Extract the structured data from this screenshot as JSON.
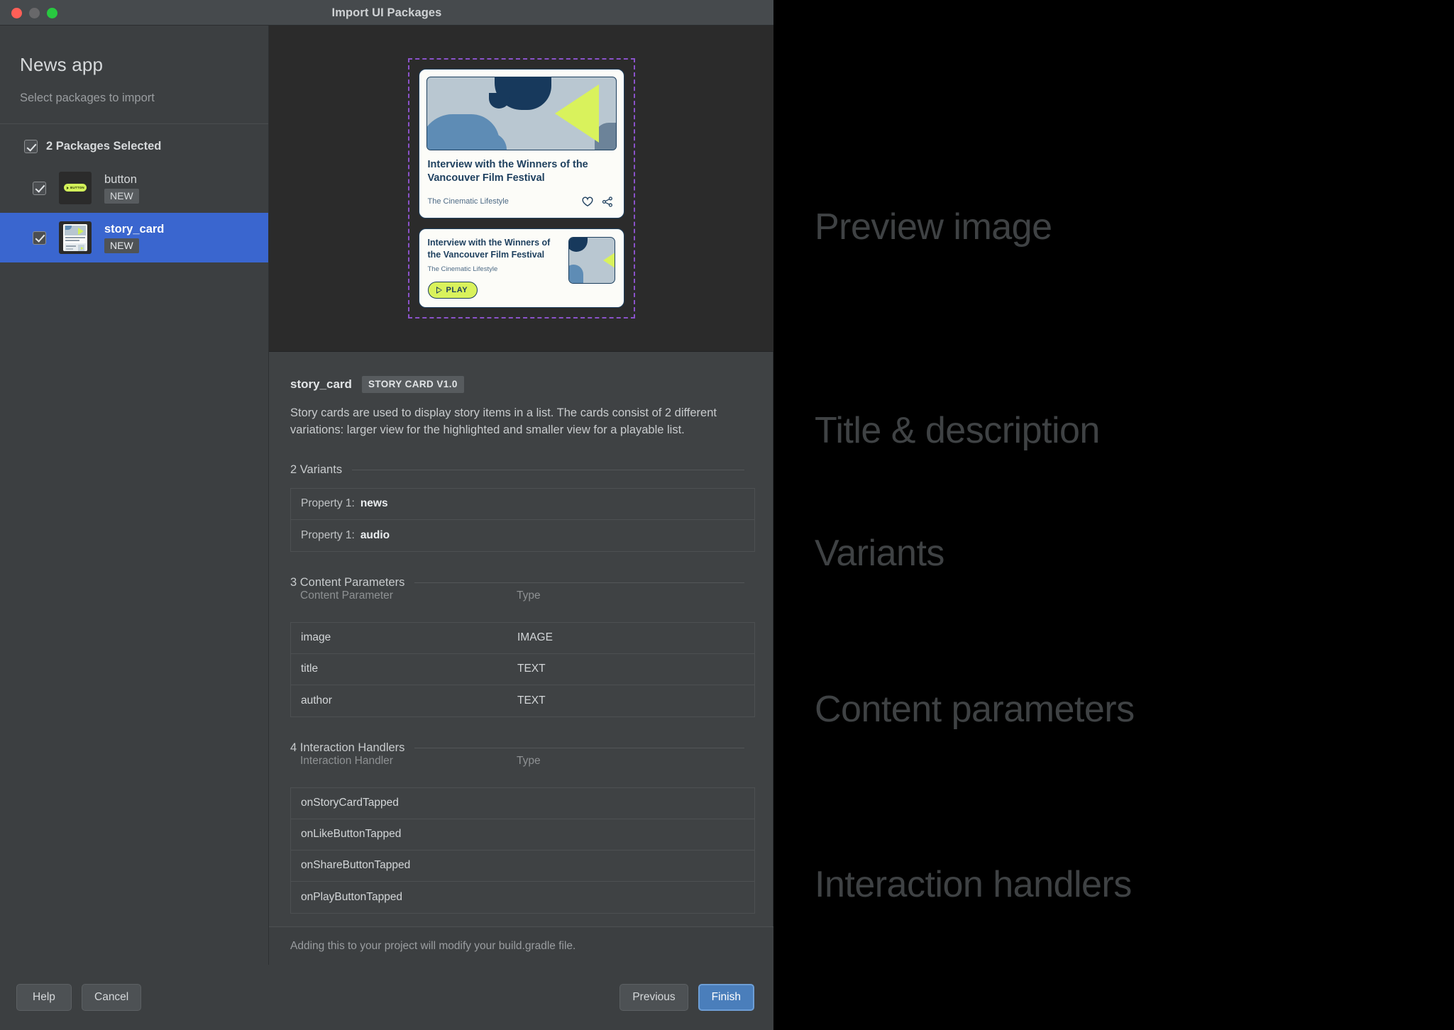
{
  "window": {
    "title": "Import UI Packages",
    "traffic_lights": [
      "close-red",
      "minimize-yellow",
      "maximize-green"
    ]
  },
  "sidebar": {
    "app_title": "News app",
    "subtitle": "Select packages to import",
    "select_all_label": "2 Packages Selected",
    "select_all_checked": true,
    "packages": [
      {
        "name": "button",
        "badge": "NEW",
        "checked": true,
        "selected": false,
        "thumb": "button-thumbnail",
        "thumb_label": "BUTTON"
      },
      {
        "name": "story_card",
        "badge": "NEW",
        "checked": true,
        "selected": true,
        "thumb": "story-card-thumbnail"
      }
    ]
  },
  "preview": {
    "big_card": {
      "title": "Interview with the Winners of the Vancouver Film Festival",
      "author": "The Cinematic Lifestyle",
      "like_icon": "heart-icon",
      "share_icon": "share-icon"
    },
    "small_card": {
      "title": "Interview with the Winners of the Vancouver Film Festival",
      "author": "The Cinematic Lifestyle",
      "play_label": "PLAY",
      "play_icon": "play-triangle-icon"
    },
    "colors": {
      "dashed_border": "#8a52c9",
      "card_bg": "#fcfcf8",
      "ink": "#1d3f5e",
      "accent_lime": "#d9f25c",
      "image_bg": "#b9c7d1",
      "blue_blob": "#5e8cb5",
      "dark_blob": "#17395c"
    }
  },
  "details": {
    "name": "story_card",
    "badge": "STORY CARD V1.0",
    "description": "Story cards are used to display story items in a list. The cards consist of 2 different variations: larger view for the highlighted and smaller view for a playable list.",
    "variants": {
      "title": "2 Variants",
      "rows": [
        {
          "key": "Property 1:",
          "value": "news"
        },
        {
          "key": "Property 1:",
          "value": "audio"
        }
      ]
    },
    "content_parameters": {
      "title": "3 Content Parameters",
      "headers": [
        "Content Parameter",
        "Type"
      ],
      "rows": [
        {
          "name": "image",
          "type": "IMAGE"
        },
        {
          "name": "title",
          "type": "TEXT"
        },
        {
          "name": "author",
          "type": "TEXT"
        }
      ]
    },
    "interaction_handlers": {
      "title": "4 Interaction Handlers",
      "headers": [
        "Interaction Handler",
        "Type"
      ],
      "rows": [
        {
          "name": "onStoryCardTapped",
          "type": ""
        },
        {
          "name": "onLikeButtonTapped",
          "type": ""
        },
        {
          "name": "onShareButtonTapped",
          "type": ""
        },
        {
          "name": "onPlayButtonTapped",
          "type": ""
        }
      ]
    }
  },
  "footer": {
    "note": "Adding this to your project will modify your build.gradle file.",
    "help": "Help",
    "cancel": "Cancel",
    "previous": "Previous",
    "finish": "Finish",
    "primary_color": "#4a7ebb"
  },
  "annotations": [
    {
      "text": "Preview image"
    },
    {
      "text": "Title & description"
    },
    {
      "text": "Variants"
    },
    {
      "text": "Content parameters"
    },
    {
      "text": "Interaction handlers"
    }
  ]
}
